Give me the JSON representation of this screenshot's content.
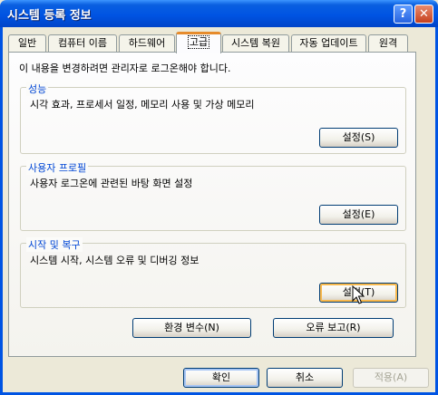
{
  "window": {
    "title": "시스템 등록 정보",
    "help_glyph": "?",
    "close_glyph": "✕"
  },
  "tabs": [
    {
      "label": "일반",
      "active": false
    },
    {
      "label": "컴퓨터 이름",
      "active": false
    },
    {
      "label": "하드웨어",
      "active": false
    },
    {
      "label": "고급",
      "active": true
    },
    {
      "label": "시스템 복원",
      "active": false
    },
    {
      "label": "자동 업데이트",
      "active": false
    },
    {
      "label": "원격",
      "active": false
    }
  ],
  "intro_text": "이 내용을 변경하려면 관리자로 로그온해야 합니다.",
  "groups": {
    "performance": {
      "title": "성능",
      "description": "시각 효과, 프로세서 일정, 메모리 사용 및 가상 메모리",
      "button": "설정(S)"
    },
    "user_profiles": {
      "title": "사용자 프로필",
      "description": "사용자 로그온에 관련된 바탕 화면 설정",
      "button": "설정(E)"
    },
    "startup_recovery": {
      "title": "시작 및 복구",
      "description": "시스템 시작, 시스템 오류 및 디버깅 정보",
      "button": "설정(T)"
    }
  },
  "env_vars_button": "환경 변수(N)",
  "error_report_button": "오류 보고(R)",
  "footer": {
    "ok": "확인",
    "cancel": "취소",
    "apply": "적용(A)"
  },
  "colors": {
    "titlebar": "#0054e3",
    "active_tab_accent": "#e68b2c",
    "group_title": "#0046d5",
    "window_face": "#ece9d8"
  }
}
